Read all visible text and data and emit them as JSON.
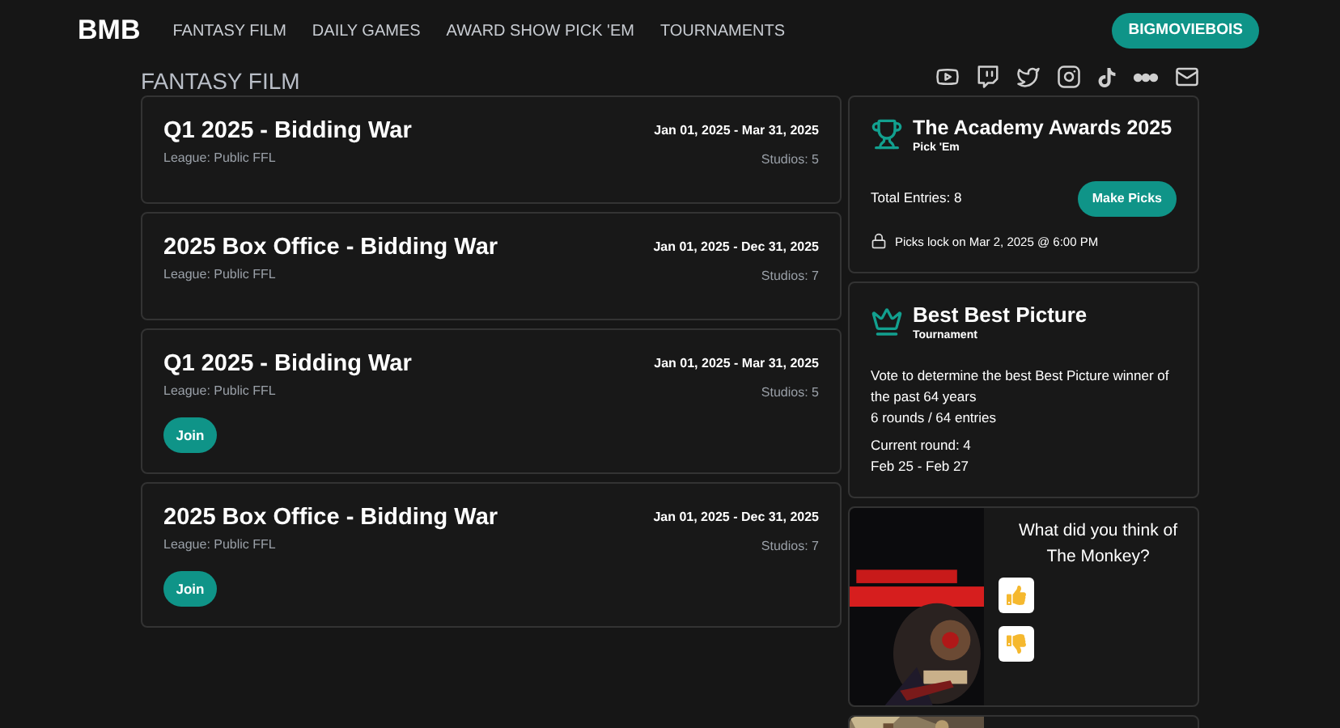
{
  "nav": {
    "logo": "BMB",
    "links": [
      "FANTASY FILM",
      "DAILY GAMES",
      "AWARD SHOW PICK 'EM",
      "TOURNAMENTS"
    ],
    "account_button": "BIGMOVIEBOIS"
  },
  "page_title": "FANTASY FILM",
  "leagues": [
    {
      "title": "Q1 2025 - Bidding War",
      "league": "League: Public FFL",
      "dates": "Jan 01, 2025 - Mar 31, 2025",
      "studios": "Studios: 5"
    },
    {
      "title": "2025 Box Office - Bidding War",
      "league": "League: Public FFL",
      "dates": "Jan 01, 2025 - Dec 31, 2025",
      "studios": "Studios: 7"
    },
    {
      "title": "Q1 2025 - Bidding War",
      "league": "League: Public FFL",
      "dates": "Jan 01, 2025 - Mar 31, 2025",
      "studios": "Studios: 5",
      "join_button": "Join"
    },
    {
      "title": "2025 Box Office - Bidding War",
      "league": "League: Public FFL",
      "dates": "Jan 01, 2025 - Dec 31, 2025",
      "studios": "Studios: 7",
      "join_button": "Join"
    }
  ],
  "pick_em": {
    "title": "The Academy Awards 2025",
    "subtitle": "Pick 'Em",
    "entries": "Total Entries: 8",
    "button": "Make Picks",
    "lock_text": "Picks lock on Mar 2, 2025 @ 6:00 PM"
  },
  "tournament": {
    "title": "Best Best Picture",
    "subtitle": "Tournament",
    "description": "Vote to determine the best Best Picture winner of the past 64 years",
    "rounds": "6 rounds / 64 entries",
    "current_round": "Current round: 4",
    "dates": "Feb 25 - Feb 27"
  },
  "polls": [
    {
      "kind": "picture",
      "question": "What did you think of The Monkey?"
    },
    {
      "kind": "picture"
    }
  ]
}
